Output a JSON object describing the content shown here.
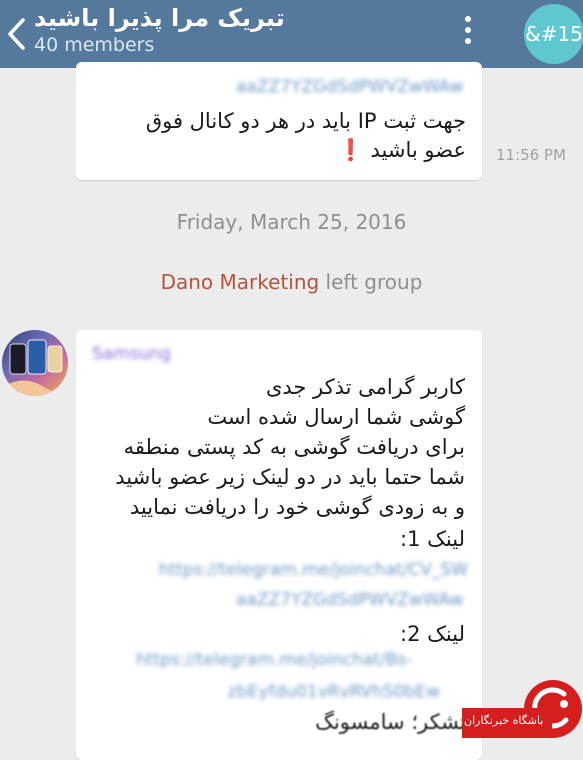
{
  "header": {
    "title": "تبریک مرا پذیرا باشید",
    "members": "40 members",
    "avatar_text": "&#15"
  },
  "messages": [
    {
      "link_blurred": "aaZZ7YZGdSdPWVZwWAw",
      "lines": [
        "جهت ثبت IP باید در هر دو کانال فوق",
        "عضو باشید ❗"
      ],
      "time": "11:56 PM"
    }
  ],
  "date_separator": "Friday, March 25, 2016",
  "service": {
    "who": "Dano Marketing",
    "action": " left group"
  },
  "message2": {
    "sender_blurred": "Samsung",
    "lines": [
      "کاربر گرامی تذکر جدی",
      "گوشی شما ارسال شده است",
      "برای دریافت گوشی به کد پستی منطقه",
      "شما حتما باید در دو لینک زیر عضو باشید",
      "و به زودی گوشی خود را دریافت نمایید",
      "لینک 1:"
    ],
    "link1_blurred": [
      "https://telegram.me/joinchat/CV_SW",
      "aaZZ7YZGdSdPWVZwWAw"
    ],
    "link2_label": "لینک 2:",
    "link2_blurred": [
      "https://telegram.me/joinchat/Bs-",
      "zbEyfdu01vRvRVhS0bEw"
    ],
    "thanks": "باتشکر؛ سامسونگ"
  },
  "watermark": {
    "text": "باشگاه خبرنگاران"
  },
  "colors": {
    "header": "#55799c",
    "header_avatar": "#5fc7d0",
    "chat_bg": "#ececec",
    "service_name": "#b5533b",
    "logo": "#d51f1f"
  }
}
